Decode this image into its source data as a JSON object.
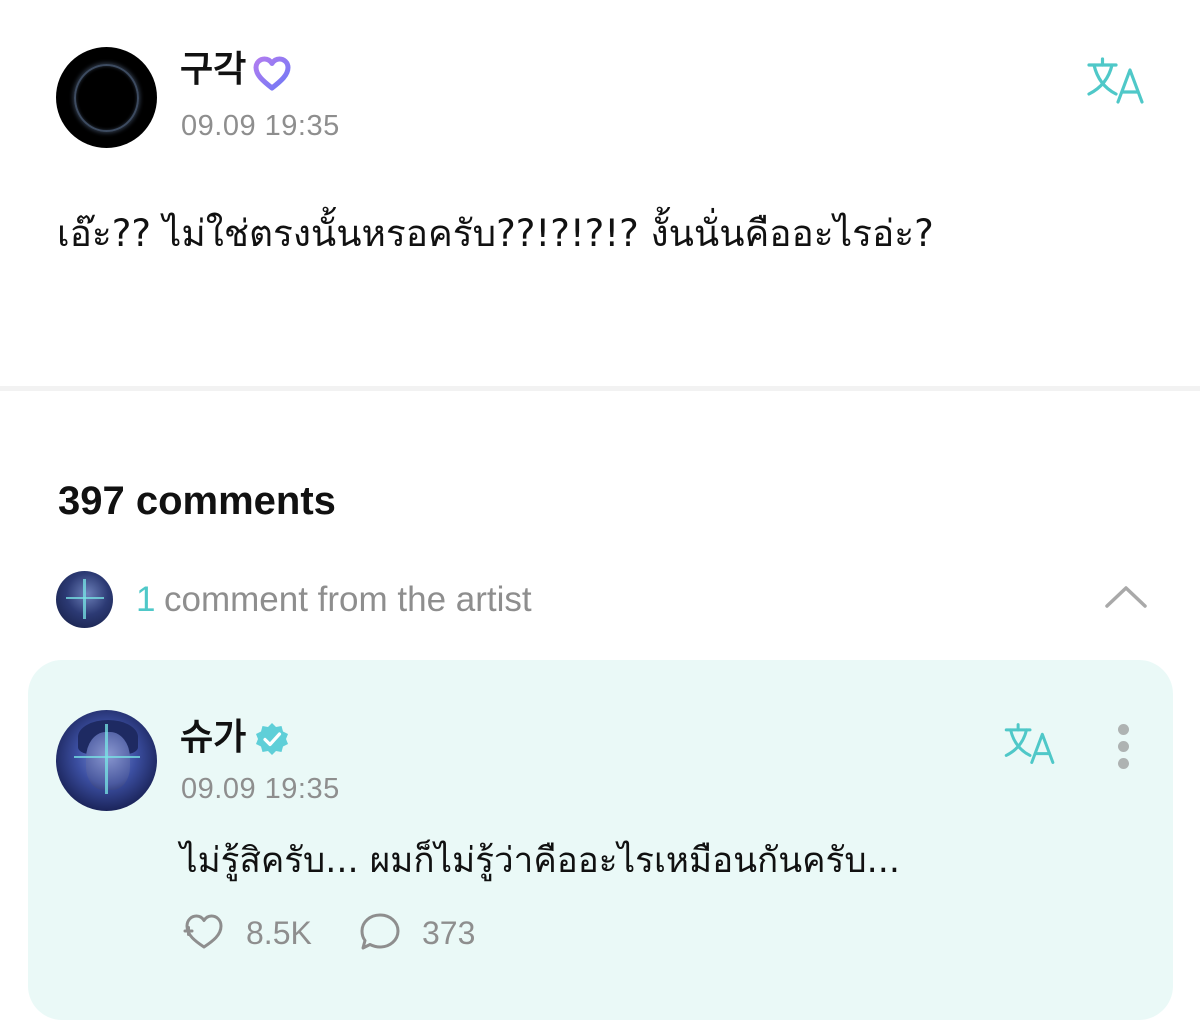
{
  "post": {
    "author_name": "구각",
    "timestamp": "09.09 19:35",
    "body": "เอ๊ะ?? ไม่ใช่ตรงนั้นหรอครับ??!?!?!? งั้นนั่นคืออะไรอ่ะ?",
    "icons": {
      "badge": "heart-badge-icon",
      "translate": "translate-icon"
    }
  },
  "comments_section": {
    "count_label": "397 comments",
    "artist_comments": {
      "count": "1",
      "label": "comment from the artist",
      "expanded": true
    }
  },
  "artist_comment": {
    "author_name": "슈가",
    "verified": true,
    "timestamp": "09.09 19:35",
    "body": "ไม่รู้สิครับ... ผมก็ไม่รู้ว่าคืออะไรเหมือนกันครับ...",
    "likes": "8.5K",
    "replies": "373",
    "icons": {
      "verified": "verified-badge-icon",
      "translate": "translate-icon",
      "menu": "more-vertical-icon",
      "like": "like-icon",
      "reply": "comment-bubble-icon"
    }
  },
  "colors": {
    "accent": "#4fc8c8",
    "card_background": "#eaf9f7",
    "muted_text": "#8e8e8e",
    "text": "#111111"
  }
}
